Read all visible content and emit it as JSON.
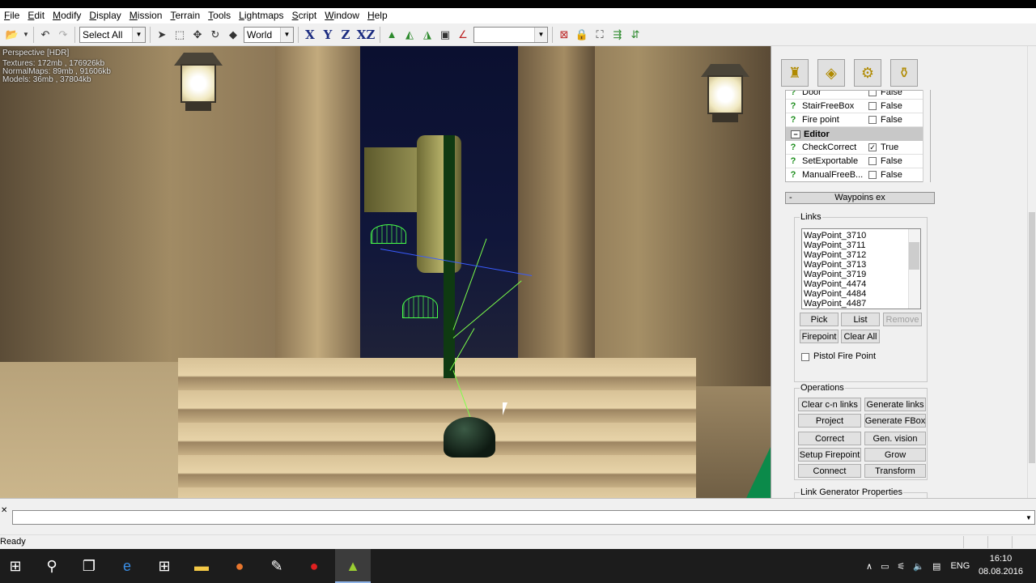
{
  "menu": [
    "File",
    "Edit",
    "Modify",
    "Display",
    "Mission",
    "Terrain",
    "Tools",
    "Lightmaps",
    "Script",
    "Window",
    "Help"
  ],
  "toolbar": {
    "selection_combo": "Select All",
    "space_combo": "World",
    "axis_x": "X",
    "axis_y": "Y",
    "axis_z": "Z",
    "axis_xz": "XZ",
    "empty_combo": ""
  },
  "viewport": {
    "line1": "Perspective [HDR]",
    "line2": "Textures: 172mb , 176926kb",
    "line3": "NormalMaps: 89mb , 91606kb",
    "line4": "Models: 36mb , 37804kb"
  },
  "properties": {
    "rows": [
      {
        "name": "Door",
        "checked": false,
        "value": "False"
      },
      {
        "name": "StairFreeBox",
        "checked": false,
        "value": "False"
      },
      {
        "name": "Fire point",
        "checked": false,
        "value": "False"
      }
    ],
    "category": "Editor",
    "editor_rows": [
      {
        "name": "CheckCorrect",
        "checked": true,
        "value": "True"
      },
      {
        "name": "SetExportable",
        "checked": false,
        "value": "False"
      },
      {
        "name": "ManualFreeB...",
        "checked": false,
        "value": "False"
      }
    ]
  },
  "waypoints": {
    "section_title": "Waypoins ex",
    "links_label": "Links",
    "links": [
      "WayPoint_3710",
      "WayPoint_3711",
      "WayPoint_3712",
      "WayPoint_3713",
      "WayPoint_3719",
      "WayPoint_4474",
      "WayPoint_4484",
      "WayPoint_4487"
    ],
    "pick": "Pick",
    "list": "List",
    "remove": "Remove",
    "firepoint": "Firepoint",
    "clear_all": "Clear All",
    "pistol_fire_point": "Pistol Fire Point"
  },
  "operations": {
    "label": "Operations",
    "buttons": [
      "Clear c-n links",
      "Generate links",
      "Project",
      "Generate FBox",
      "Correct",
      "Gen. vision",
      "Setup Firepoint",
      "Grow",
      "Connect",
      "Transform"
    ]
  },
  "link_generator_label": "Link Generator Properties",
  "status": "Ready",
  "tray": {
    "lang": "ENG",
    "time": "16:10",
    "date": "08.08.2016"
  }
}
